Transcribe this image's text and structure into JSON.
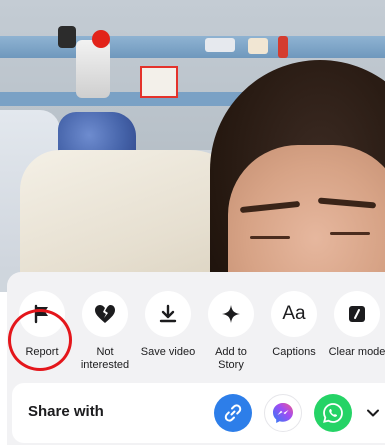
{
  "actions": [
    {
      "id": "report",
      "label": "Report",
      "icon": "flag-icon"
    },
    {
      "id": "not-interested",
      "label": "Not\ninterested",
      "icon": "broken-heart-icon"
    },
    {
      "id": "save-video",
      "label": "Save video",
      "icon": "download-icon"
    },
    {
      "id": "add-to-story",
      "label": "Add to\nStory",
      "icon": "sparkle-icon"
    },
    {
      "id": "captions",
      "label": "Captions",
      "icon": "captions-icon",
      "glyph": "Aa"
    },
    {
      "id": "clear-mode",
      "label": "Clear mode",
      "icon": "clear-mode-icon"
    }
  ],
  "share": {
    "title": "Share with",
    "targets": [
      {
        "id": "copy-link",
        "icon": "link-icon",
        "color": "#2d7ee9"
      },
      {
        "id": "messenger",
        "icon": "messenger-icon",
        "color": "#8b5cf6"
      },
      {
        "id": "whatsapp",
        "icon": "whatsapp-icon",
        "color": "#25d366"
      }
    ],
    "more_icon": "chevron-down-icon"
  },
  "highlight": {
    "target": "report",
    "color": "#e4161b"
  }
}
